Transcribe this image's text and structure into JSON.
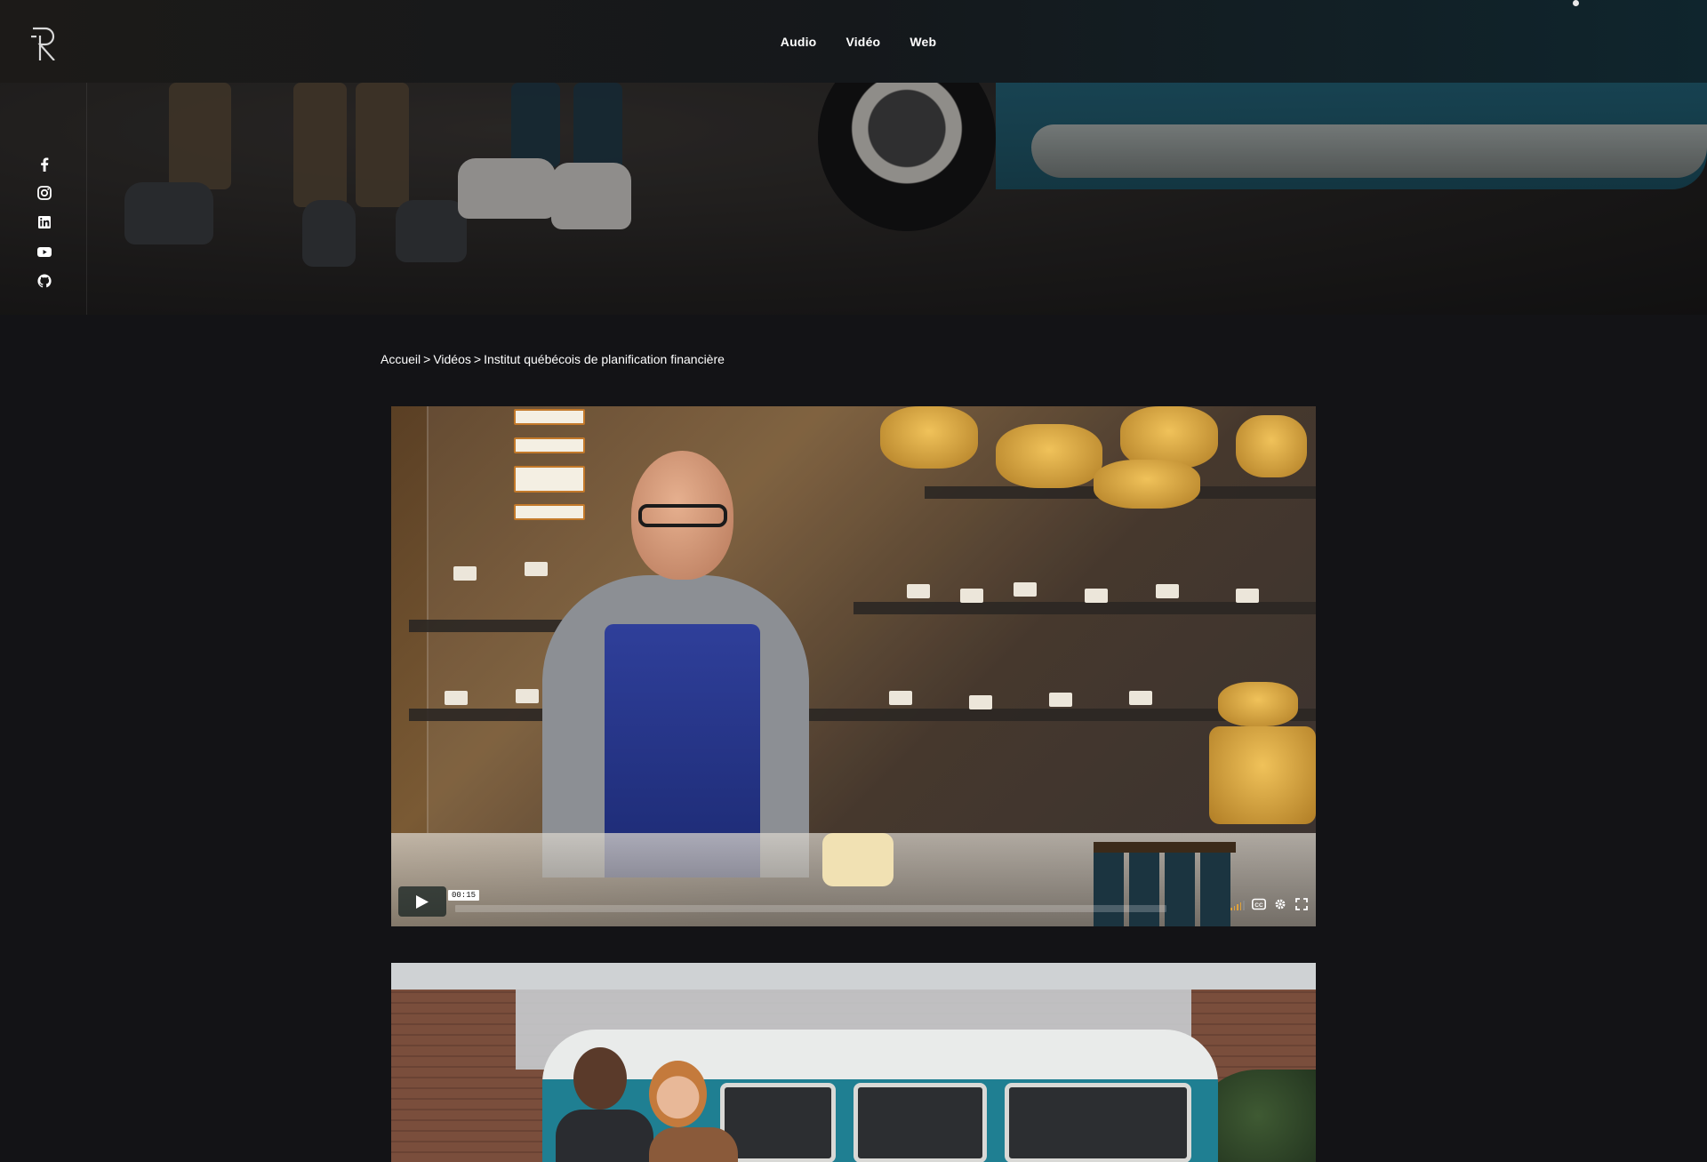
{
  "nav": {
    "items": [
      {
        "label": "Audio"
      },
      {
        "label": "Vidéo"
      },
      {
        "label": "Web"
      }
    ]
  },
  "social": [
    {
      "icon": "facebook-icon"
    },
    {
      "icon": "instagram-icon"
    },
    {
      "icon": "linkedin-icon"
    },
    {
      "icon": "youtube-icon"
    },
    {
      "icon": "github-icon"
    }
  ],
  "breadcrumb": {
    "home": "Accueil",
    "separator": ">",
    "section": "Vidéos",
    "current": "Institut québécois de planification financière"
  },
  "player": {
    "time": "00:15",
    "icons": [
      "play-icon",
      "volume-icon",
      "captions-icon",
      "settings-icon",
      "fullscreen-icon"
    ]
  },
  "colors": {
    "background": "#131316",
    "accent_volume": "#e0a23a",
    "text": "#ffffff"
  }
}
